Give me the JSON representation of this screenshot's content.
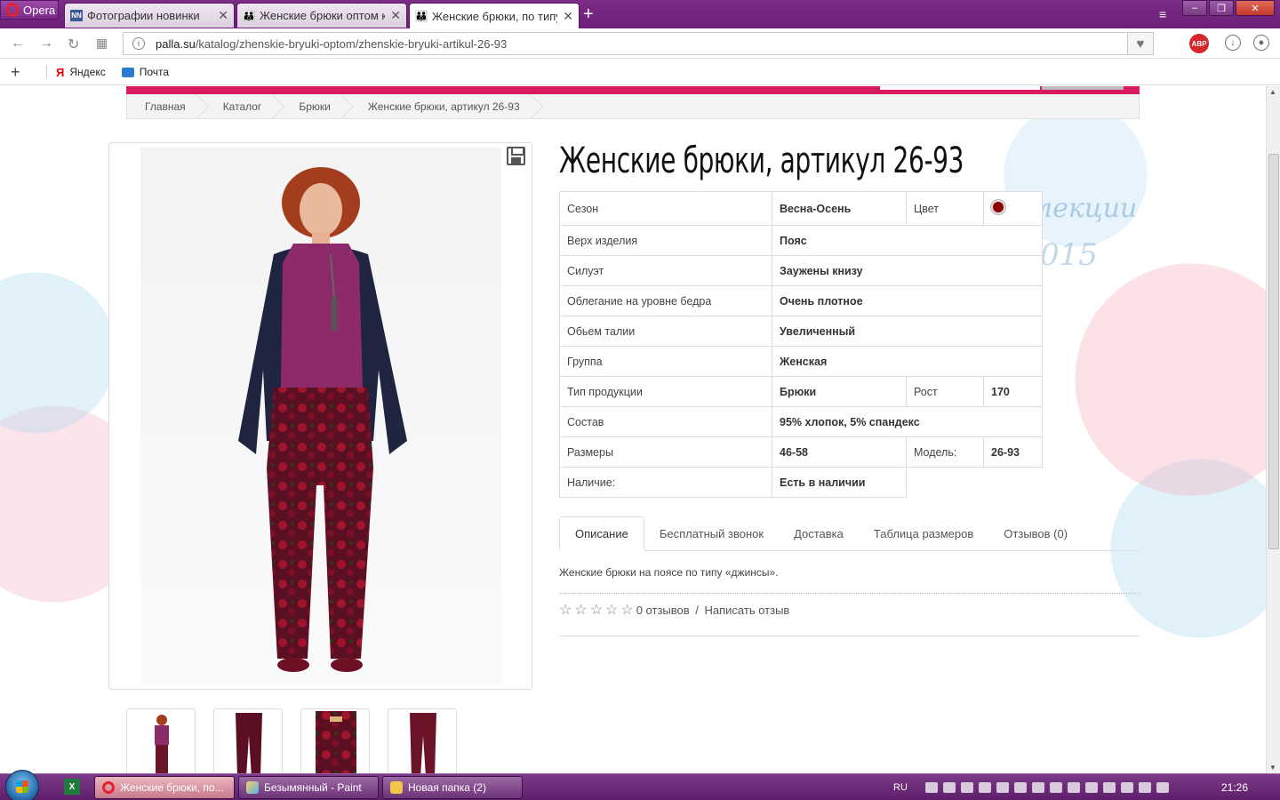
{
  "browser": {
    "menu_label": "Opera",
    "tabs": [
      {
        "title": "Фотографии новинки",
        "icon": "nn-favicon",
        "close": "✕"
      },
      {
        "title": "Женские брюки оптом кур",
        "icon": "palla-favicon",
        "close": "✕"
      },
      {
        "title": "Женские брюки, по типу",
        "icon": "palla-favicon",
        "close": "✕"
      }
    ],
    "url_host": "palla.su",
    "url_path": "/katalog/zhenskie-bryuki-optom/zhenskie-bryuki-artikul-26-93",
    "abp_label": "ABP",
    "bookmarks": [
      {
        "label": "Яндекс",
        "icon": "yandex-icon"
      },
      {
        "label": "Почта",
        "icon": "mail-icon"
      }
    ]
  },
  "breadcrumb": [
    "Главная",
    "Каталог",
    "Брюки",
    "Женские брюки, артикул 26-93"
  ],
  "background_text": {
    "line1": "лекции",
    "line2": "015"
  },
  "product": {
    "title": "Женские брюки, артикул 26-93",
    "attributes": [
      {
        "label": "Сезон",
        "value": "Весна-Осень",
        "label2": "Цвет",
        "color": "#8b0000"
      },
      {
        "label": "Верх изделия",
        "value": "Пояс"
      },
      {
        "label": "Силуэт",
        "value": "Заужены книзу"
      },
      {
        "label": "Облегание на уровне бедра",
        "value": "Очень плотное"
      },
      {
        "label": "Обьем талии",
        "value": "Увеличенный"
      },
      {
        "label": "Группа",
        "value": "Женская"
      },
      {
        "label": "Тип продукции",
        "value": "Брюки",
        "label2": "Рост",
        "value2": "170"
      },
      {
        "label": "Состав",
        "value": "95% хлопок, 5% спандекс"
      },
      {
        "label": "Размеры",
        "value": "46-58",
        "label2": "Модель:",
        "value2": "26-93"
      },
      {
        "label": "Наличие:",
        "value": "Есть в наличии"
      }
    ],
    "tabs": [
      "Описание",
      "Бесплатный звонок",
      "Доставка",
      "Таблица размеров",
      "Отзывов (0)"
    ],
    "active_tab": "Описание",
    "description": "Женские брюки на поясе по типу «джинсы».",
    "rating": {
      "stars": 0,
      "max": 5,
      "reviews_text": "0 отзывов",
      "separator": " / ",
      "write_review": "Написать отзыв"
    }
  },
  "taskbar": {
    "buttons": [
      {
        "label": "Женские брюки, по...",
        "active": true
      },
      {
        "label": "Безымянный - Paint",
        "active": false
      },
      {
        "label": "Новая папка (2)",
        "active": false
      }
    ],
    "language": "RU",
    "time": "21:26"
  }
}
